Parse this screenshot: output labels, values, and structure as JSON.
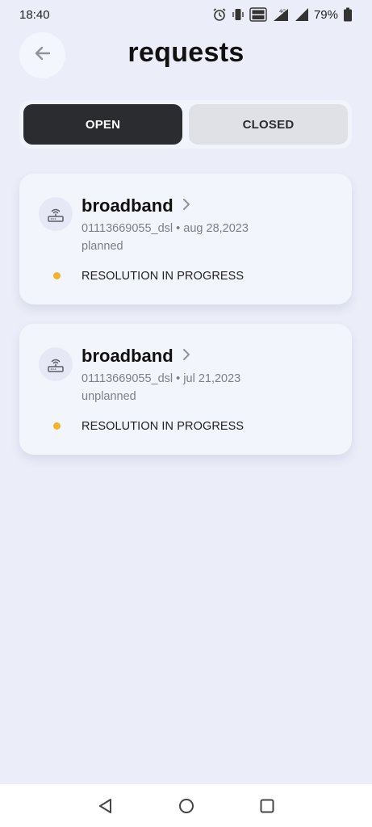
{
  "status_bar": {
    "time": "18:40",
    "battery": "79%",
    "network": "4G",
    "icons": [
      "alarm-icon",
      "vibrate-icon",
      "volte-icon",
      "signal-icon",
      "signal-icon",
      "battery-icon"
    ]
  },
  "header": {
    "title": "requests",
    "back_icon": "arrow-left-icon"
  },
  "tabs": [
    {
      "label": "OPEN",
      "active": true
    },
    {
      "label": "CLOSED",
      "active": false
    }
  ],
  "requests": [
    {
      "title": "broadband",
      "meta": "01113669055_dsl • aug 28,2023",
      "type": "planned",
      "status": "RESOLUTION IN PROGRESS",
      "status_color": "#f3b32d",
      "icon": "router-icon"
    },
    {
      "title": "broadband",
      "meta": "01113669055_dsl • jul 21,2023",
      "type": "unplanned",
      "status": "RESOLUTION IN PROGRESS",
      "status_color": "#f3b32d",
      "icon": "router-icon"
    }
  ],
  "nav_bar": {
    "icons": [
      "back-triangle-icon",
      "home-circle-icon",
      "recents-square-icon"
    ]
  },
  "colors": {
    "background": "#ebeef9",
    "card": "#f3f5fd",
    "tab_active": "#2a2c30",
    "tab_inactive": "#dfe1e6",
    "status_in_progress": "#f3b32d"
  }
}
